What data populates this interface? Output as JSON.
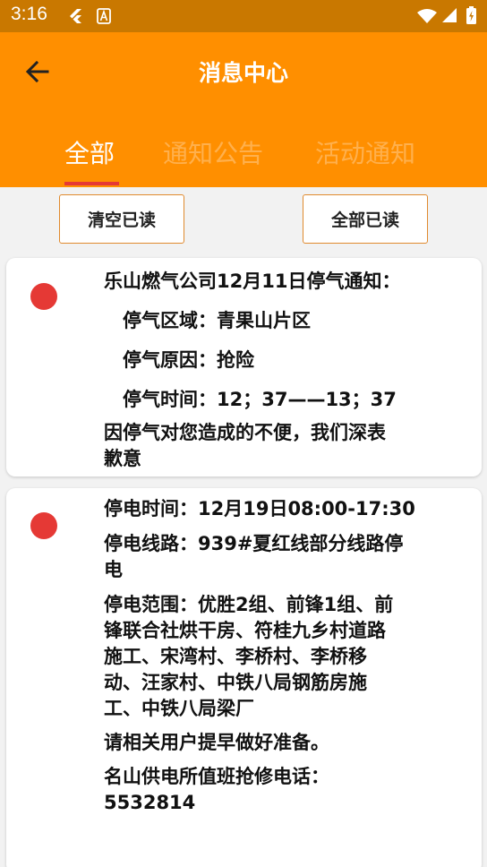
{
  "status_bar": {
    "time": "3:16"
  },
  "header": {
    "title": "消息中心",
    "tabs": [
      {
        "label": "全部",
        "active": true
      },
      {
        "label": "通知公告",
        "active": false
      },
      {
        "label": "活动通知",
        "active": false
      }
    ]
  },
  "actions": {
    "clear_read": "清空已读",
    "mark_all_read": "全部已读"
  },
  "messages": [
    {
      "unread": true,
      "lines": [
        "乐山燃气公司12月11日停气通知：",
        "停气区域：青果山片区",
        "停气原因：抢险",
        "停气时间：12；37——13；37",
        "因停气对您造成的不便，我们深表",
        "歉意"
      ]
    },
    {
      "unread": true,
      "lines": [
        "停电时间：12月19日08:00-17:30",
        "停电线路：939#夏红线部分线路停",
        "电",
        "停电范围：优胜2组、前锋1组、前",
        "锋联合社烘干房、符桂九乡村道路",
        "施工、宋湾村、李桥村、李桥移",
        "动、汪家村、中铁八局钢筋房施",
        "工、中铁八局梁厂",
        "请相关用户提早做好准备。",
        "名山供电所值班抢修电话：",
        "5532814"
      ]
    }
  ],
  "colors": {
    "header": "#ff8f00",
    "status_bar": "#c97800",
    "unread_dot": "#e53935",
    "button_border": "#e08a2e"
  }
}
